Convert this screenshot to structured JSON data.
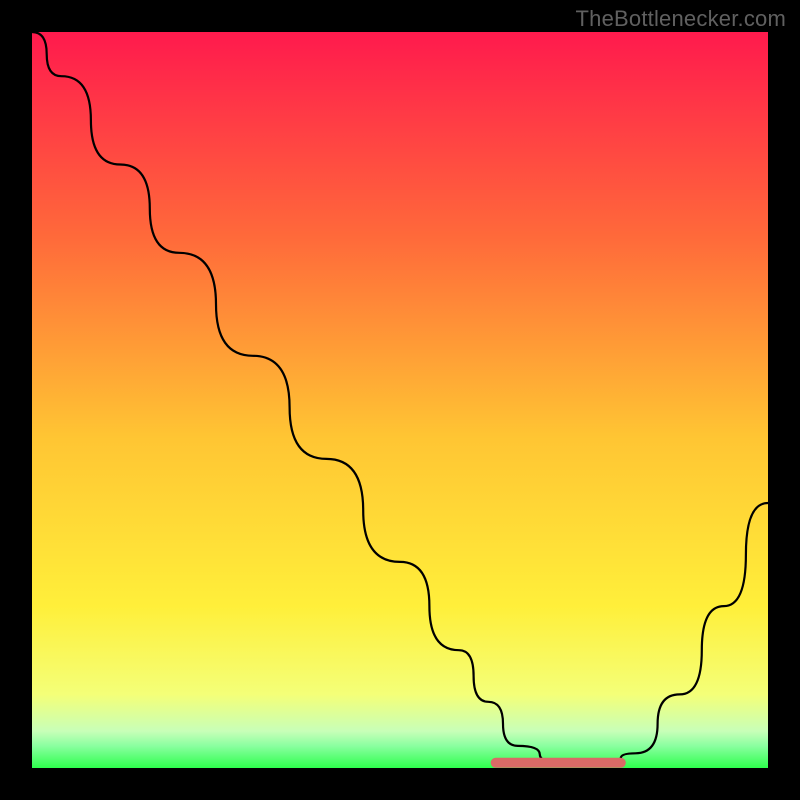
{
  "watermark": "TheBottlenecker.com",
  "chart_data": {
    "type": "line",
    "title": "",
    "xlabel": "",
    "ylabel": "",
    "xlim": [
      0,
      100
    ],
    "ylim": [
      0,
      100
    ],
    "background_gradient": {
      "top": "#ff1a4d",
      "mid1": "#ff7a33",
      "mid2": "#ffe033",
      "near_bottom": "#f8ff66",
      "bottom": "#2eff4d"
    },
    "series": [
      {
        "name": "bottleneck-curve",
        "color": "#000000",
        "x": [
          0,
          4,
          12,
          20,
          30,
          40,
          50,
          58,
          62,
          66,
          72,
          78,
          82,
          88,
          94,
          100
        ],
        "y": [
          100,
          94,
          82,
          70,
          56,
          42,
          28,
          16,
          9,
          3,
          0.7,
          0.7,
          2,
          10,
          22,
          36
        ]
      }
    ],
    "flat_region": {
      "name": "optimal-zone",
      "color": "#d96a66",
      "x_start": 63,
      "x_end": 80,
      "y": 0.7
    }
  }
}
